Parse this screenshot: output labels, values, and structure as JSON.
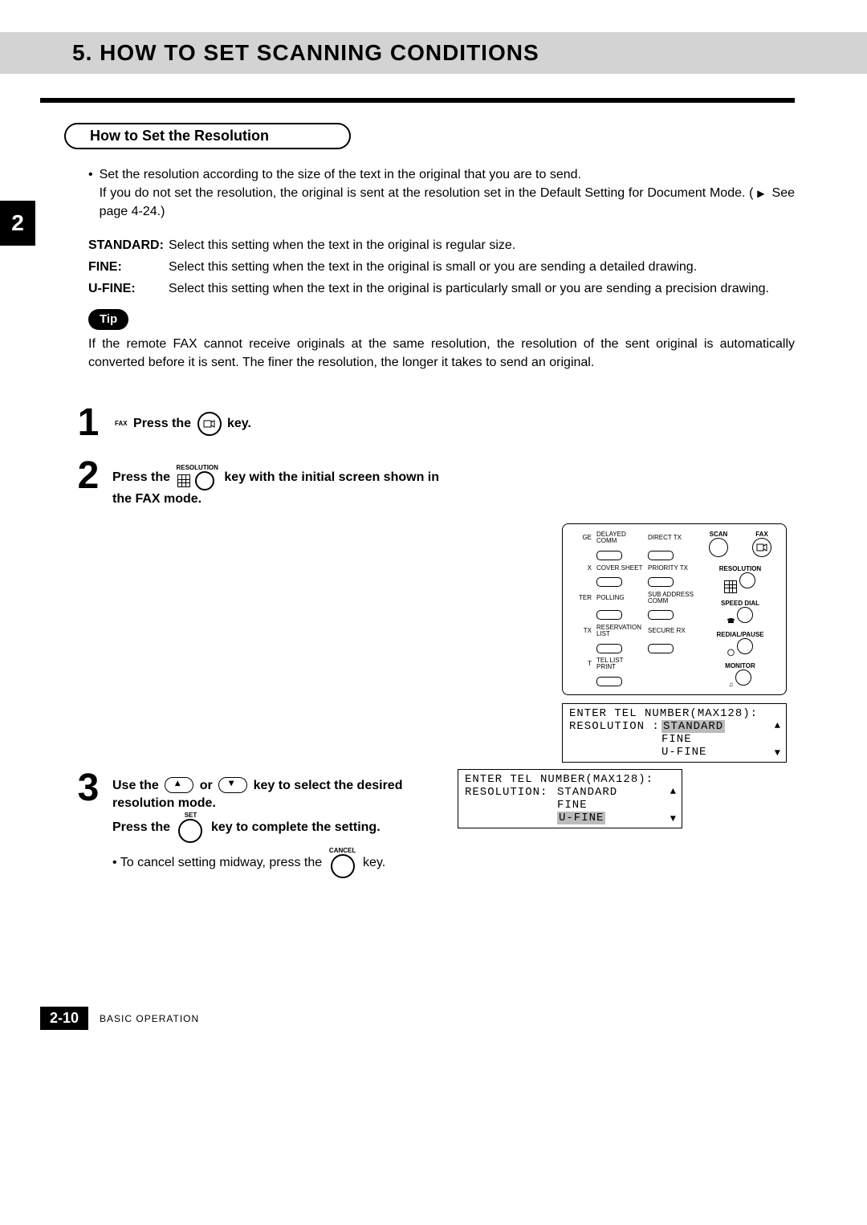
{
  "title": "5. HOW TO SET SCANNING CONDITIONS",
  "side_tab": "2",
  "section_heading": "How to Set the Resolution",
  "intro_bullet": "Set the resolution according to the size of the text in the original  that you are to send.",
  "intro_line2": "If you do not set the resolution, the original is sent at the resolution set in the Default Setting for Document Mode. (",
  "intro_see": " See page 4-24.)",
  "defs": {
    "standard": {
      "term": "STANDARD",
      "colon": ": ",
      "text": "Select this setting when the text in the original is regular size."
    },
    "fine": {
      "term": "FINE",
      "colon": ":",
      "text": "Select this setting when the text in the original is small or you are sending a detailed drawing."
    },
    "ufine": {
      "term": "U-FINE",
      "colon": ":",
      "text": "Select this setting when the text in the original is particularly small or you are sending a precision drawing."
    }
  },
  "tip_label": "Tip",
  "tip_text": "If the remote FAX cannot receive originals at the same resolution, the resolution of the sent original is automatically converted before it is sent.  The finer the resolution, the longer it takes to send an original.",
  "step1": {
    "pre": "Press the ",
    "post": " key.",
    "icon_label": "FAX"
  },
  "step2": {
    "pre": "Press the ",
    "mid": " key with the initial screen shown in the FAX mode.",
    "icon_label": "RESOLUTION"
  },
  "step3": {
    "line1_a": "Use the ",
    "line1_b": " or ",
    "line1_c": " key to select the desired resolution mode.",
    "line2_a": "Press the ",
    "line2_b": " key to complete the setting.",
    "set_label": "SET",
    "sub_a": "To cancel setting midway, press the ",
    "sub_b": " key.",
    "cancel_label": "CANCEL"
  },
  "panel": {
    "scan": "SCAN",
    "fax": "FAX",
    "resolution": "RESOLUTION",
    "speed_dial": "SPEED DIAL",
    "redial": "REDIAL/PAUSE",
    "monitor": "MONITOR",
    "col1": [
      "GE",
      "",
      "X",
      "",
      "TER",
      "",
      "TX",
      "",
      "T",
      ""
    ],
    "labels": [
      [
        "DELAYED COMM",
        "DIRECT TX"
      ],
      [
        "COVER SHEET",
        "PRIORITY TX"
      ],
      [
        "POLLING",
        "SUB ADDRESS COMM"
      ],
      [
        "RESERVATION LIST",
        "SECURE RX"
      ],
      [
        "TEL LIST PRINT",
        ""
      ]
    ]
  },
  "lcd1": {
    "line1": "ENTER TEL NUMBER(MAX128):",
    "k": "RESOLUTION :",
    "v1": "STANDARD",
    "v2": "FINE",
    "v3": "U-FINE"
  },
  "lcd2": {
    "line1": "ENTER TEL NUMBER(MAX128):",
    "k": "RESOLUTION:",
    "v1": "STANDARD",
    "v2": "FINE",
    "v3": "U-FINE"
  },
  "footer": {
    "page": "2-10",
    "section": "BASIC OPERATION"
  }
}
